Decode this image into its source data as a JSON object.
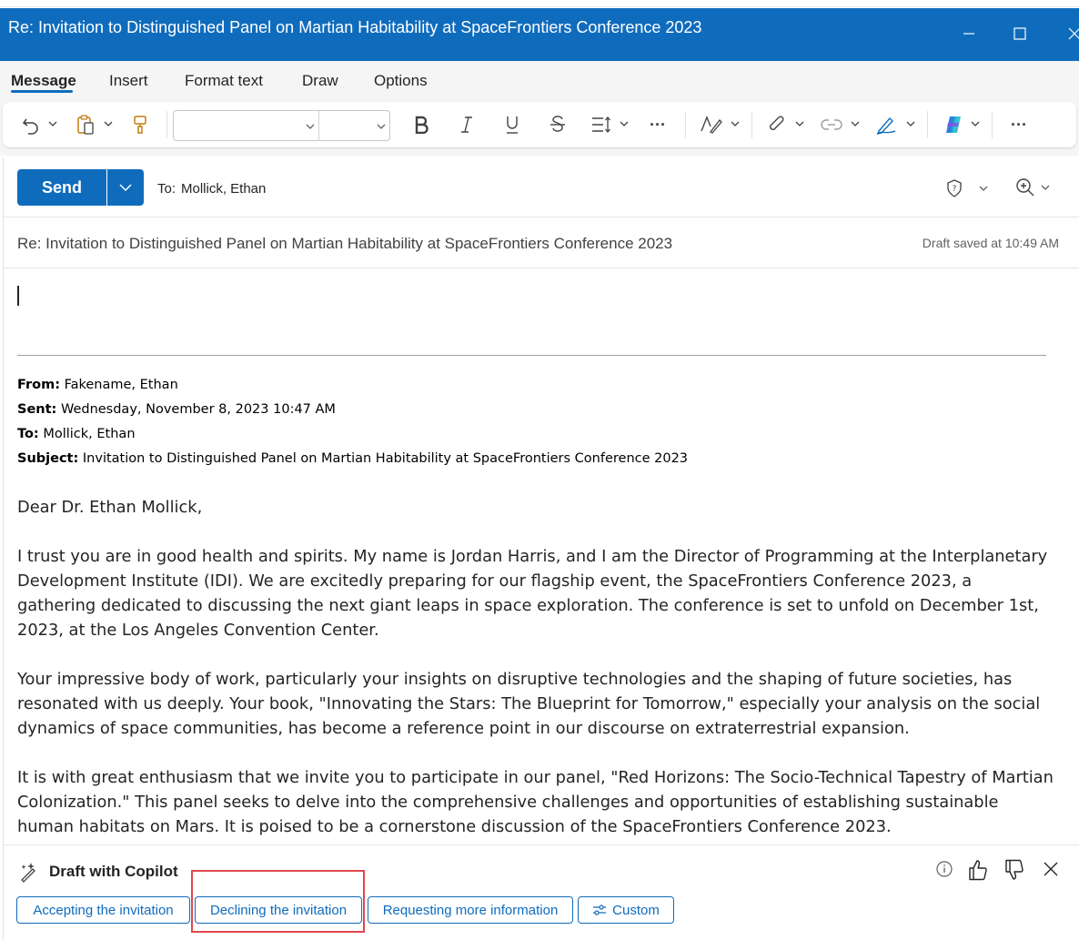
{
  "window": {
    "title": "Re: Invitation to Distinguished Panel on Martian Habitability at SpaceFrontiers Conference 2023"
  },
  "ribbon": {
    "tabs": [
      "Message",
      "Insert",
      "Format text",
      "Draw",
      "Options"
    ],
    "active_tab": "Message"
  },
  "toolbar": {
    "font_name": "",
    "font_size": "",
    "more_label": "···"
  },
  "compose": {
    "send_label": "Send",
    "to_label": "To:",
    "to_value": "Mollick, Ethan",
    "subject": "Re:  Invitation to Distinguished Panel on Martian Habitability at SpaceFrontiers Conference 2023",
    "draft_status": "Draft saved at 10:49 AM"
  },
  "quoted": {
    "from_label": "From:",
    "from_value": " Fakename, Ethan",
    "sent_label": "Sent:",
    "sent_value": " Wednesday, November 8, 2023 10:47 AM",
    "to_label": "To:",
    "to_value": " Mollick, Ethan",
    "subject_label": "Subject:",
    "subject_value": " Invitation to Distinguished Panel on Martian Habitability at SpaceFrontiers Conference 2023",
    "greeting": "Dear Dr. Ethan Mollick,",
    "paragraphs": [
      "I trust you are in good health and spirits. My name is Jordan Harris, and I am the Director of Programming at the Interplanetary Development Institute (IDI). We are excitedly preparing for our flagship event, the SpaceFrontiers Conference 2023, a gathering dedicated to discussing the next giant leaps in space exploration. The conference is set to unfold on December 1st, 2023, at the Los Angeles Convention Center.",
      "Your impressive body of work, particularly your insights on disruptive technologies and the shaping of future societies, has resonated with us deeply. Your book, \"Innovating the Stars: The Blueprint for Tomorrow,\" especially your analysis on the social dynamics of space communities, has become a reference point in our discourse on extraterrestrial expansion.",
      "It is with great enthusiasm that we invite you to participate in our panel, \"Red Horizons: The Socio-Technical Tapestry of Martian Colonization.\" This panel seeks to delve into the comprehensive challenges and opportunities of establishing sustainable human habitats on Mars. It is poised to be a cornerstone discussion of the SpaceFrontiers Conference 2023."
    ]
  },
  "copilot": {
    "title": "Draft with Copilot",
    "options": [
      "Accepting the invitation",
      "Declining the invitation",
      "Requesting more information",
      "Custom"
    ],
    "highlighted_option": "Declining the invitation"
  },
  "colors": {
    "accent": "#0f6cbd",
    "highlight": "#e0474c"
  }
}
